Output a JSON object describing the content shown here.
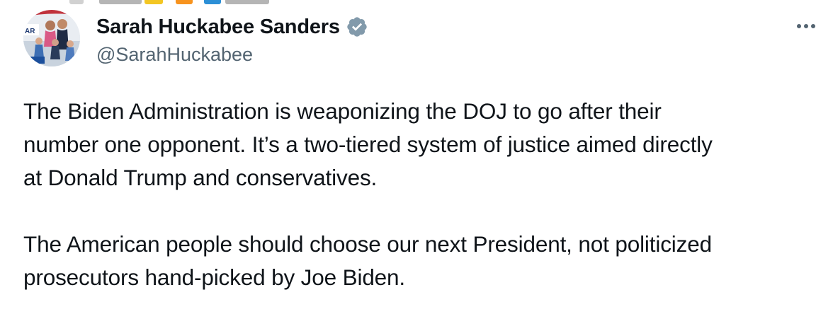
{
  "author": {
    "display_name": "Sarah Huckabee Sanders",
    "handle": "@SarahHuckabee",
    "verified": true
  },
  "avatar": {
    "sign_text": "AR"
  },
  "icons": {
    "verified": "verified-badge-icon",
    "more": "more-options-icon"
  },
  "tweet": {
    "lines": [
      "The Biden Administration is weaponizing the DOJ to go after their",
      "number one opponent. It’s a two-tiered system of justice aimed directly",
      "at Donald Trump and conservatives.",
      "The American people should choose our next President, not politicized",
      "prosecutors hand-picked by Joe Biden."
    ]
  },
  "colors": {
    "text_primary": "#0f1419",
    "text_secondary": "#536471",
    "verified_badge": "#829aab",
    "background": "#ffffff"
  }
}
